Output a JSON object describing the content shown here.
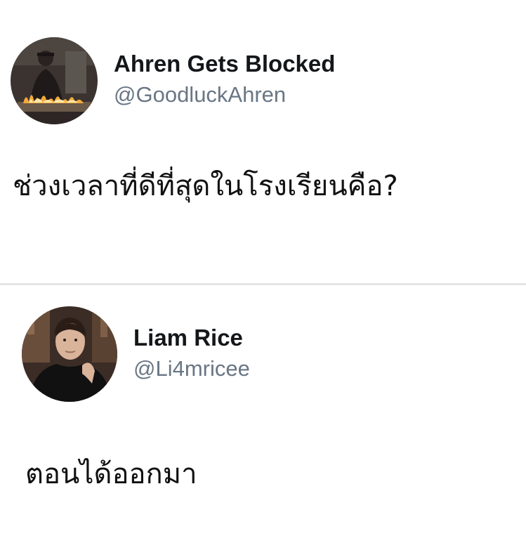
{
  "tweets": [
    {
      "avatar_icon": "profile-photo-fire",
      "display_name": "Ahren Gets Blocked",
      "handle": "@GoodluckAhren",
      "text": "ช่วงเวลาที่ดีที่สุดในโรงเรียนคือ?"
    },
    {
      "avatar_icon": "profile-photo-portrait",
      "display_name": "Liam Rice",
      "handle": "@Li4mricee",
      "text": "ตอนได้ออกมา"
    }
  ],
  "colors": {
    "background": "#ffffff",
    "display_name": "#14171a",
    "handle": "#697684",
    "divider": "#e3e4e6"
  }
}
